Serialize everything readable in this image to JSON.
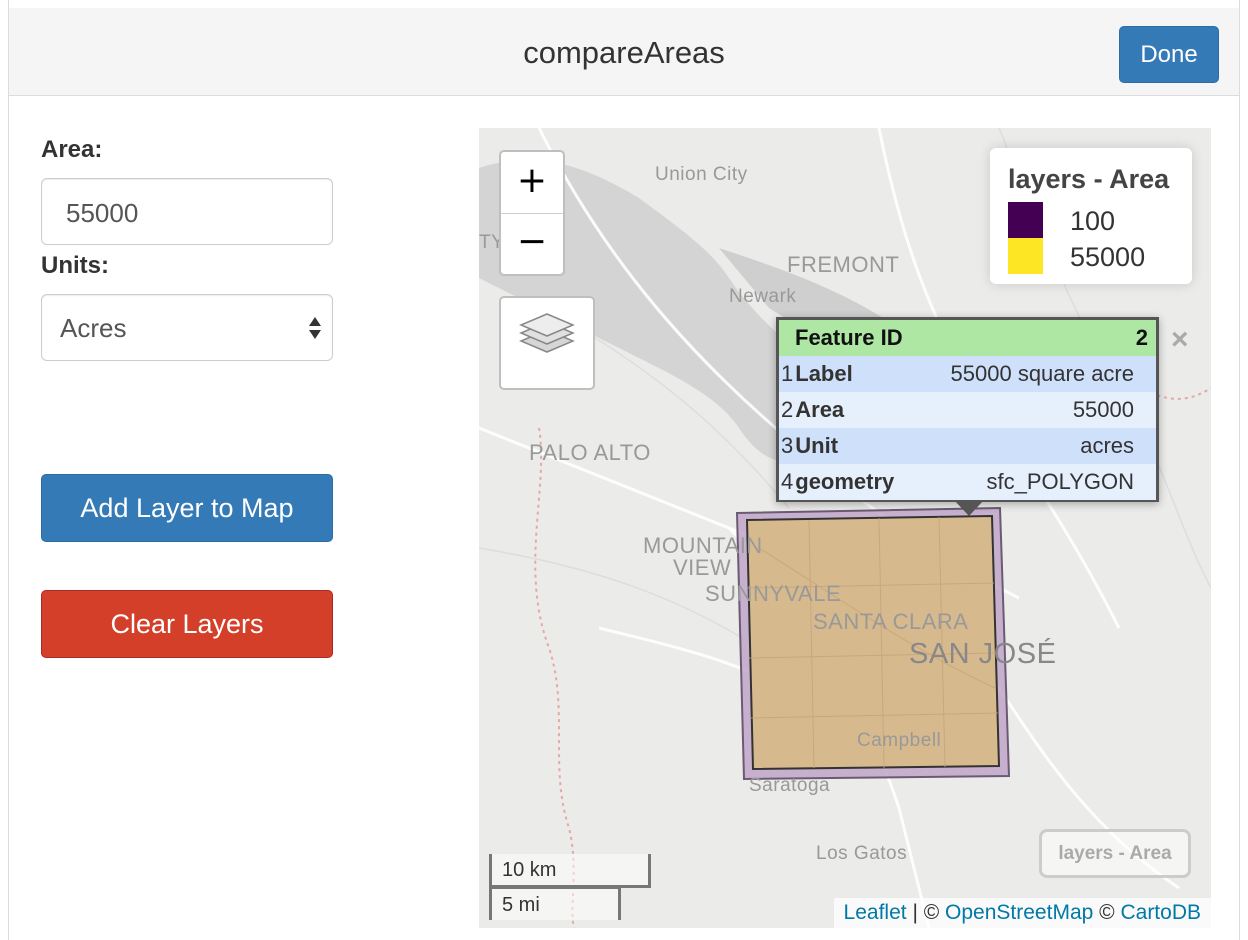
{
  "app": {
    "title": "compareAreas",
    "done_label": "Done"
  },
  "form": {
    "area_label": "Area:",
    "area_value": "55000",
    "units_label": "Units:",
    "units_selected": "Acres",
    "add_layer_label": "Add Layer to Map",
    "clear_layers_label": "Clear Layers"
  },
  "map": {
    "zoom_in": "+",
    "zoom_out": "−",
    "legend": {
      "title": "layers - Area",
      "items": [
        {
          "label": "100",
          "color": "#440154"
        },
        {
          "label": "55000",
          "color": "#fde725"
        }
      ]
    },
    "popup": {
      "header_key": "Feature ID",
      "header_value": "2",
      "rows": [
        {
          "n": "1",
          "key": "Label",
          "value": "55000 square acre"
        },
        {
          "n": "2",
          "key": "Area",
          "value": "55000"
        },
        {
          "n": "3",
          "key": "Unit",
          "value": "acres"
        },
        {
          "n": "4",
          "key": "geometry",
          "value": "sfc_POLYGON"
        }
      ],
      "close": "×"
    },
    "places": {
      "union_city": "Union City",
      "fremont": "FREMONT",
      "newark": "Newark",
      "palo_alto": "PALO ALTO",
      "mountain": "MOUNTAIN",
      "view": "VIEW",
      "sunnyvale": "SUNNYVALE",
      "santa_clara": "SANTA CLARA",
      "san_jose": "SAN JOSÉ",
      "campbell": "Campbell",
      "saratoga": "Saratoga",
      "los_gatos": "Los Gatos",
      "edge_ty": "TY"
    },
    "scale_km": "10 km",
    "scale_mi": "5 mi",
    "layer_toggle_label": "layers - Area",
    "attribution": {
      "leaflet": "Leaflet",
      "sep1": " | © ",
      "osm": "OpenStreetMap",
      "sep2": " © ",
      "carto": "CartoDB"
    }
  }
}
